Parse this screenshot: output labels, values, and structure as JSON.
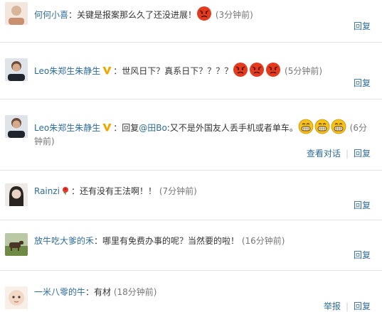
{
  "comments": [
    {
      "name": "何何小喜",
      "text_before": "：关键是报案那么久了还没进展！",
      "emoji_count": 1,
      "time": "(3分钟前)",
      "actions": [
        "回复"
      ]
    },
    {
      "name": "Leo朱郑生朱静生",
      "verified": true,
      "text_before": "：世风日下？真系日下？？？？",
      "emoji_count": 3,
      "time": "(5分钟前)",
      "actions": [
        "回复"
      ]
    },
    {
      "name": "Leo朱郑生朱静生",
      "verified": true,
      "text_before": "：回复",
      "mention": "@田Bo",
      "text_after": ":又不是外国友人丢手机或者单车。",
      "emoji_count": 3,
      "time": "(6分钟前)",
      "actions": [
        "查看对话",
        "回复"
      ]
    },
    {
      "name": "Rainzi",
      "badge": "rose",
      "text_before": "：还有没有王法啊！！",
      "time": "(7分钟前)",
      "actions": [
        "回复"
      ]
    },
    {
      "name": "放牛吃大爹的禾",
      "text_before": "：哪里有免费办事的呢？当然要的啦！",
      "time": "(16分钟前)",
      "actions": [
        "回复"
      ]
    },
    {
      "name": "一米八零的牛",
      "text_before": "：有材",
      "time": "(18分钟前)",
      "actions": [
        "举报",
        "回复"
      ]
    }
  ],
  "colors": {
    "link": "#2f6c97",
    "text": "#333333",
    "time": "#777777",
    "angry_emoji": "#e33b1f",
    "grin_emoji": "#f5c21a",
    "verified_badge": "#f0a800"
  },
  "icons": {
    "angry_emoji": "angry-face-icon",
    "grin_emoji": "grin-face-icon",
    "verified": "verified-v-icon",
    "rose": "rose-badge-icon"
  }
}
